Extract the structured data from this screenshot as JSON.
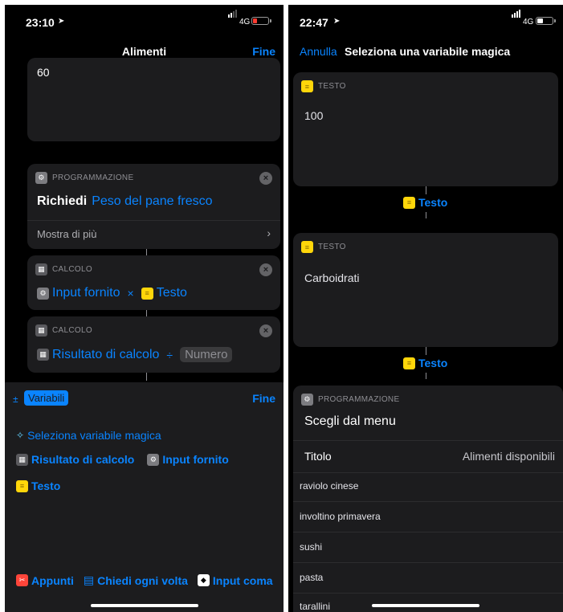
{
  "left": {
    "status": {
      "time": "23:10",
      "network": "4G"
    },
    "header": {
      "title": "Alimenti",
      "done": "Fine"
    },
    "text_card": {
      "value": "60"
    },
    "ask_card": {
      "category": "PROGRAMMAZIONE",
      "action": "Richiedi",
      "parameter": "Peso del pane fresco",
      "show_more": "Mostra di più"
    },
    "calc1": {
      "category": "CALCOLO",
      "operand1": "Input fornito",
      "operator": "×",
      "operand2": "Testo"
    },
    "calc2": {
      "category": "CALCOLO",
      "operand1": "Risultato di calcolo",
      "operator": "÷",
      "operand2": "Numero"
    },
    "variables": {
      "pm": "±",
      "tab": "Variabili",
      "done": "Fine",
      "magic": "Seleziona variabile magica",
      "items": [
        "Risultato di calcolo",
        "Input fornito",
        "Testo"
      ],
      "bottom": [
        "Appunti",
        "Chiedi ogni volta",
        "Input coma"
      ]
    }
  },
  "right": {
    "status": {
      "time": "22:47",
      "network": "4G"
    },
    "header": {
      "cancel": "Annulla",
      "title": "Seleziona una variabile magica"
    },
    "text1": {
      "category": "TESTO",
      "value": "100",
      "magic_var": "Testo"
    },
    "text2": {
      "category": "TESTO",
      "value": "Carboidrati",
      "magic_var": "Testo"
    },
    "menu": {
      "category": "PROGRAMMAZIONE",
      "title": "Scegli dal menu",
      "label": "Titolo",
      "label_value": "Alimenti disponibili",
      "items": [
        "raviolo cinese",
        "involtino primavera",
        "sushi",
        "pasta",
        "tarallini"
      ]
    }
  },
  "colors": {
    "accent": "#0a84ff",
    "card": "#1c1c1e",
    "text_icon": "#ffd60a",
    "clipboard_icon": "#ff453a"
  }
}
